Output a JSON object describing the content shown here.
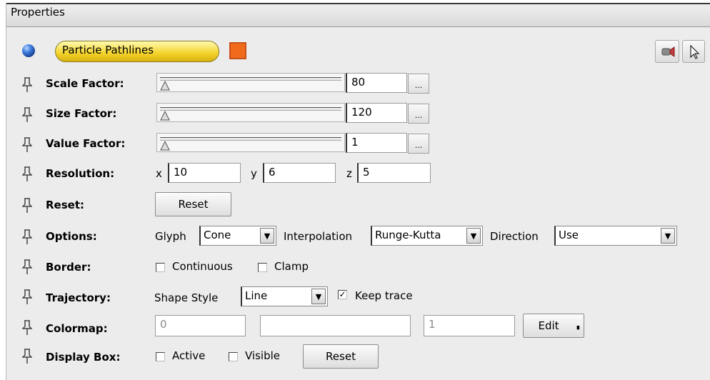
{
  "panel": {
    "title": "Properties"
  },
  "header": {
    "object_name": "Particle Pathlines",
    "swatch_color": "#f26b1d",
    "icons": [
      "camera-icon",
      "pointer-icon"
    ]
  },
  "rows": {
    "scale_factor": {
      "label": "Scale Factor:",
      "value": "80",
      "more": "..."
    },
    "size_factor": {
      "label": "Size Factor:",
      "value": "120",
      "more": "..."
    },
    "value_factor": {
      "label": "Value Factor:",
      "value": "1",
      "more": "..."
    },
    "resolution": {
      "label": "Resolution:",
      "x_label": "x",
      "x_value": "10",
      "y_label": "y",
      "y_value": "6",
      "z_label": "z",
      "z_value": "5"
    },
    "reset": {
      "label": "Reset:",
      "button": "Reset"
    },
    "options": {
      "label": "Options:",
      "glyph_label": "Glyph",
      "glyph_value": "Cone",
      "interp_label": "Interpolation",
      "interp_value": "Runge-Kutta",
      "direction_label": "Direction",
      "direction_value": "Use"
    },
    "border": {
      "label": "Border:",
      "continuous": "Continuous",
      "clamp": "Clamp"
    },
    "trajectory": {
      "label": "Trajectory:",
      "shape_label": "Shape Style",
      "shape_value": "Line",
      "keep_trace": "Keep trace",
      "keep_trace_mark": "✓"
    },
    "colormap": {
      "label": "Colormap:",
      "min": "0",
      "max": "1",
      "edit": "Edit"
    },
    "display_box": {
      "label": "Display Box:",
      "active": "Active",
      "visible": "Visible",
      "reset": "Reset"
    }
  }
}
